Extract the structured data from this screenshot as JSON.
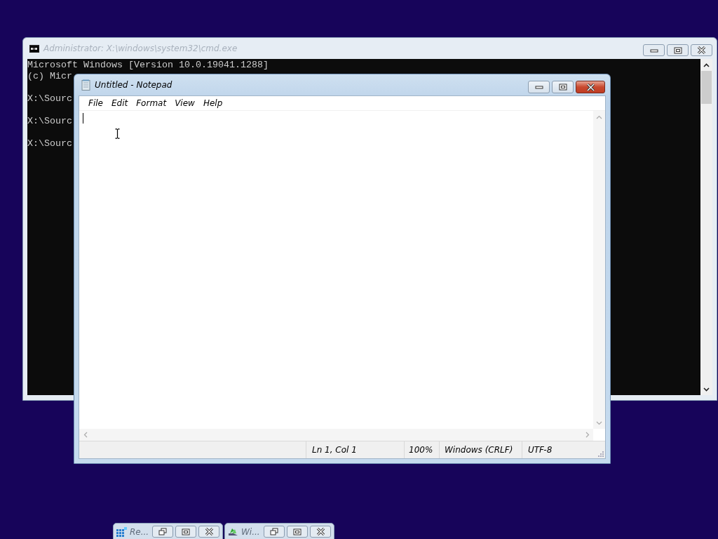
{
  "cmd_window": {
    "title": "Administrator: X:\\windows\\system32\\cmd.exe",
    "active": false,
    "lines": [
      {
        "text": "Microsoft Windows [Version 10.0.19041.1288]",
        "kind": "output"
      },
      {
        "text": "(c) Micr",
        "kind": "output"
      },
      {
        "text": "X:\\Sourc",
        "kind": "prompt"
      },
      {
        "text": "X:\\Sourc",
        "kind": "prompt"
      },
      {
        "text": "X:\\Sourc",
        "kind": "prompt"
      }
    ]
  },
  "notepad": {
    "title": "Untitled - Notepad",
    "active": true,
    "menu": [
      "File",
      "Edit",
      "Format",
      "View",
      "Help"
    ],
    "status": [
      "Ln 1, Col 1",
      "100%",
      "Windows (CRLF)",
      "UTF-8"
    ]
  },
  "minimized": [
    {
      "title": "Re...",
      "kind": "recovery"
    },
    {
      "title": "Wi...",
      "kind": "setup"
    }
  ]
}
